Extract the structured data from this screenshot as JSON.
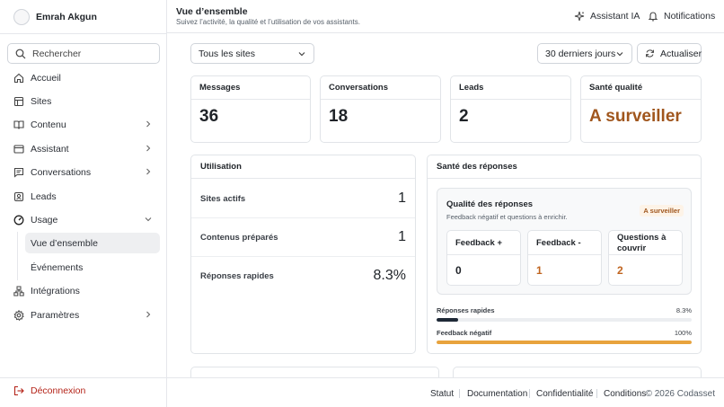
{
  "user": {
    "name": "Emrah Akgun"
  },
  "sidebar": {
    "search_label": "Rechercher",
    "items": [
      {
        "label": "Accueil",
        "icon": "home-icon"
      },
      {
        "label": "Sites",
        "icon": "layout-icon"
      },
      {
        "label": "Contenu",
        "icon": "book-icon"
      },
      {
        "label": "Assistant",
        "icon": "browser-icon"
      },
      {
        "label": "Conversations",
        "icon": "chat-icon"
      },
      {
        "label": "Leads",
        "icon": "contact-icon"
      },
      {
        "label": "Usage",
        "icon": "gauge-icon"
      },
      {
        "label": "Intégrations",
        "icon": "integrations-icon"
      },
      {
        "label": "Paramètres",
        "icon": "gear-icon"
      }
    ],
    "usage_sub": [
      {
        "label": "Vue d’ensemble",
        "active": true
      },
      {
        "label": "Événements",
        "active": false
      }
    ],
    "logout_label": "Déconnexion"
  },
  "header": {
    "title": "Vue d’ensemble",
    "subtitle": "Suivez l’activité, la qualité et l’utilisation de vos assistants.",
    "assistant_label": "Assistant IA",
    "notifications_label": "Notifications"
  },
  "filters": {
    "site_select": "Tous les sites",
    "period_select": "30 derniers jours",
    "refresh_label": "Actualiser"
  },
  "kpis": [
    {
      "label": "Messages",
      "value": "36"
    },
    {
      "label": "Conversations",
      "value": "18"
    },
    {
      "label": "Leads",
      "value": "2"
    },
    {
      "label": "Santé qualité",
      "value": "A surveiller"
    }
  ],
  "utilisation": {
    "title": "Utilisation",
    "rows": [
      {
        "label": "Sites actifs",
        "value": "1"
      },
      {
        "label": "Contenus préparés",
        "value": "1"
      },
      {
        "label": "Réponses rapides",
        "value": "8.3%"
      }
    ]
  },
  "health": {
    "title": "Santé des réponses",
    "quality_title": "Qualité des réponses",
    "quality_sub": "Feedback négatif et questions à enrichir.",
    "badge": "A surveiller",
    "feedback": [
      {
        "label": "Feedback +",
        "value": "0"
      },
      {
        "label": "Feedback -",
        "value": "1"
      },
      {
        "label": "Questions à couvrir",
        "value": "2"
      }
    ],
    "bars": [
      {
        "label": "Réponses rapides",
        "pct_text": "8.3%",
        "fraction": 0.083,
        "color": "#1f2937"
      },
      {
        "label": "Feedback négatif",
        "pct_text": "100%",
        "fraction": 1.0,
        "color": "#e8a33d"
      }
    ]
  },
  "footer": {
    "links": [
      "Statut",
      "Documentation",
      "Confidentialité",
      "Conditions"
    ],
    "copyright": "© 2026 Codasset"
  }
}
